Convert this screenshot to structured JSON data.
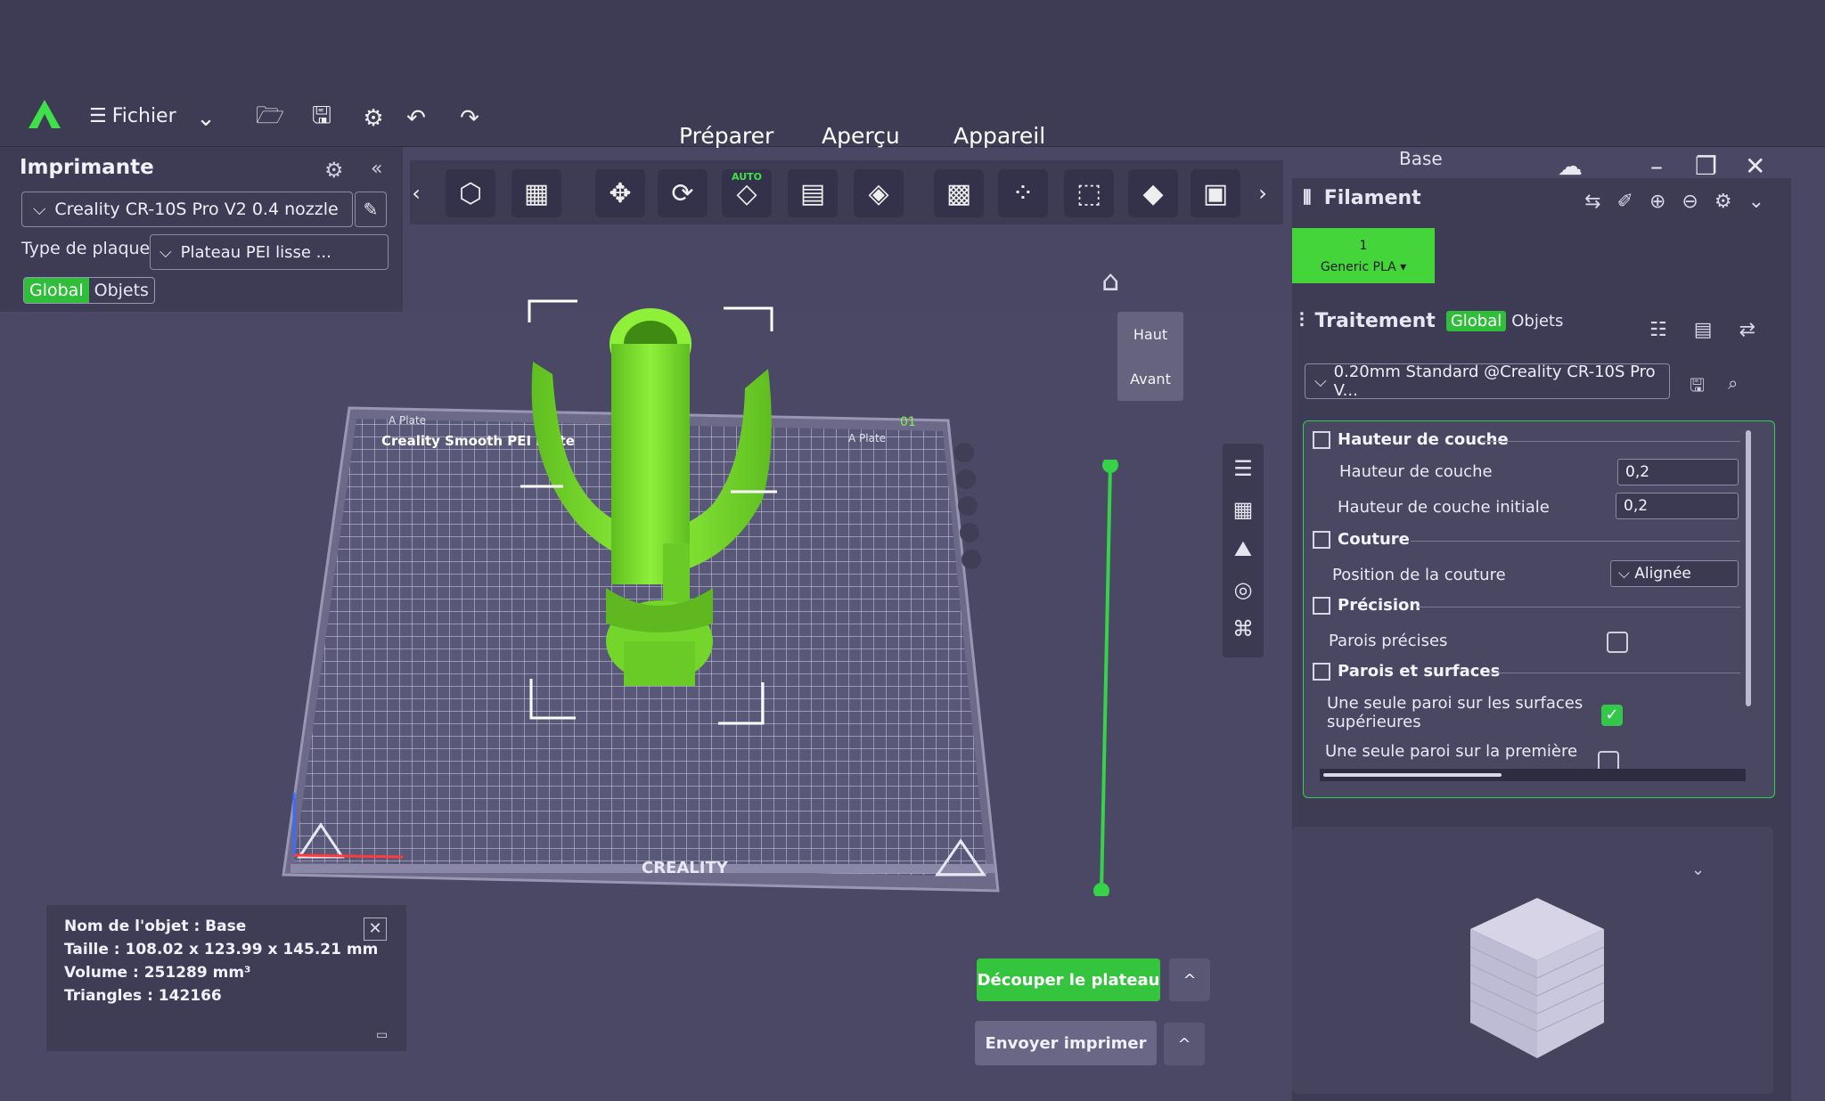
{
  "menu": {
    "file_label": "Fichier"
  },
  "tabs": [
    "Préparer",
    "Aperçu",
    "Appareil"
  ],
  "plate_name": "Base",
  "printer_panel": {
    "title": "Imprimante",
    "printer": "Creality CR-10S Pro V2 0.4 nozzle",
    "plate_type_label": "Type de plaque",
    "plate_type": "Plateau PEI lisse ...",
    "scope_global": "Global",
    "scope_objects": "Objets"
  },
  "view_cube": {
    "top": "Haut",
    "front": "Avant"
  },
  "object_info": {
    "name": "Nom de l'objet : Base",
    "size": "Taille : 108.02 x 123.99 x 145.21 mm",
    "volume": "Volume : 251289 mm³",
    "triangles": "Triangles : 142166"
  },
  "actions": {
    "slice": "Découper le plateau",
    "send": "Envoyer imprimer"
  },
  "filament": {
    "title": "Filament",
    "slot": "1",
    "material": "Generic PLA ▾"
  },
  "process": {
    "title": "Traitement",
    "scope_global": "Global",
    "scope_objects": "Objets",
    "preset": "0.20mm Standard @Creality CR-10S Pro V...",
    "sections": {
      "layer_height": "Hauteur de couche",
      "seam": "Couture",
      "precision": "Précision",
      "walls": "Parois et surfaces"
    },
    "options": {
      "layer_height": "Hauteur de couche",
      "layer_height_val": "0,2",
      "initial_layer_height": "Hauteur de couche initiale",
      "initial_layer_height_val": "0,2",
      "seam_position": "Position de la couture",
      "seam_position_val": "Alignée",
      "precise_walls": "Parois précises",
      "single_wall_top_1": "Une seule paroi sur les surfaces",
      "single_wall_top_2": "supérieures",
      "single_wall_first": "Une seule paroi sur la première"
    }
  },
  "bed_labels": {
    "brand": "CREALITY",
    "plate_text": "Creality Smooth PEI Plate",
    "tag": "A Plate",
    "index": "01"
  },
  "colors": {
    "accent": "#35c43e",
    "model": "#7ee02a",
    "panel": "#3e3b55",
    "viewport": "#4b4866"
  }
}
